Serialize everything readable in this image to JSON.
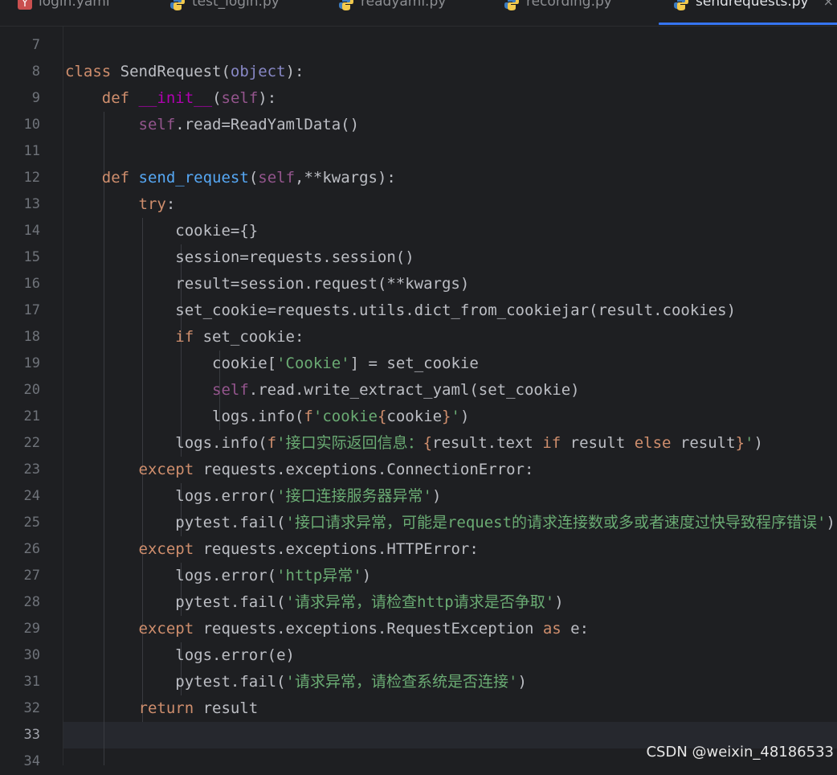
{
  "tabs": [
    {
      "label": "login.yaml",
      "icon": "yaml-icon",
      "active": false
    },
    {
      "label": "test_login.py",
      "icon": "python-icon",
      "active": false
    },
    {
      "label": "readyaml.py",
      "icon": "python-icon",
      "active": false
    },
    {
      "label": "recording.py",
      "icon": "python-icon",
      "active": false
    },
    {
      "label": "sendrequests.py",
      "icon": "python-icon",
      "active": true
    }
  ],
  "tab_close_symbol": "×",
  "line_numbers": [
    "7",
    "8",
    "9",
    "10",
    "11",
    "12",
    "13",
    "14",
    "15",
    "16",
    "17",
    "18",
    "19",
    "20",
    "21",
    "22",
    "23",
    "24",
    "25",
    "26",
    "27",
    "28",
    "29",
    "30",
    "31",
    "32",
    "33",
    "34"
  ],
  "current_line": "33",
  "code": [
    "",
    "class SendRequest(object):",
    "    def __init__(self):",
    "        self.read=ReadYamlData()",
    "",
    "    def send_request(self,**kwargs):",
    "        try:",
    "            cookie={}",
    "            session=requests.session()",
    "            result=session.request(**kwargs)",
    "            set_cookie=requests.utils.dict_from_cookiejar(result.cookies)",
    "            if set_cookie:",
    "                cookie['Cookie'] = set_cookie",
    "                self.read.write_extract_yaml(set_cookie)",
    "                logs.info(f'cookie{cookie}')",
    "            logs.info(f'接口实际返回信息：{result.text if result else result}')",
    "        except requests.exceptions.ConnectionError:",
    "            logs.error('接口连接服务器异常')",
    "            pytest.fail('接口请求异常，可能是request的请求连接数或多或者速度过快导致程序错误')",
    "        except requests.exceptions.HTTPError:",
    "            logs.error('http异常')",
    "            pytest.fail('请求异常，请检查http请求是否争取')",
    "        except requests.exceptions.RequestException as e:",
    "            logs.error(e)",
    "            pytest.fail('请求异常，请检查系统是否连接')",
    "        return result",
    "",
    ""
  ],
  "watermark": "CSDN @weixin_48186533",
  "colors": {
    "background": "#1e1f22",
    "keyword": "#cf8e6d",
    "self": "#94558d",
    "function": "#56a8f5",
    "string": "#6aab73",
    "builtin": "#8888c6",
    "magic": "#b200b2",
    "accent": "#3574f0"
  }
}
